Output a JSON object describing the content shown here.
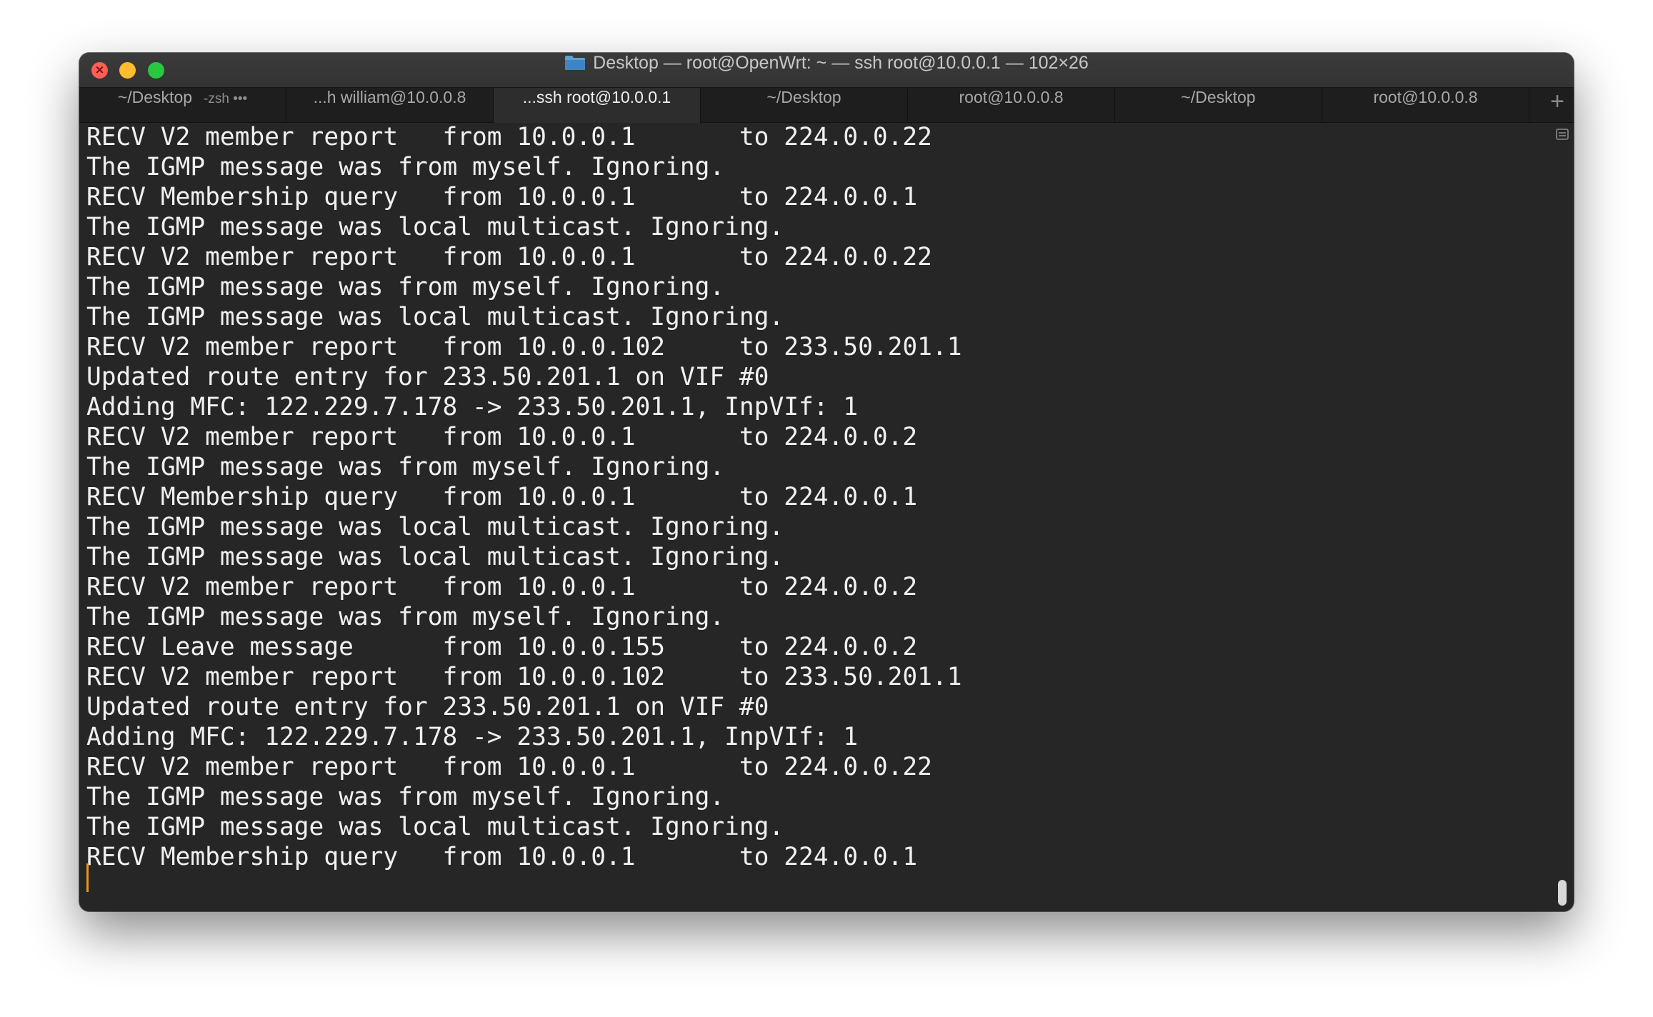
{
  "window": {
    "title": "Desktop — root@OpenWrt: ~ — ssh root@10.0.0.1 — 102×26",
    "title_icon": "folder-icon"
  },
  "tabs": [
    {
      "label": "~/Desktop",
      "sub": "-zsh •••",
      "active": false
    },
    {
      "label": "...h william@10.0.0.8",
      "active": false
    },
    {
      "label": "...ssh root@10.0.0.1",
      "active": true
    },
    {
      "label": "~/Desktop",
      "active": false
    },
    {
      "label": "root@10.0.0.8",
      "active": false
    },
    {
      "label": "~/Desktop",
      "active": false
    },
    {
      "label": "root@10.0.0.8",
      "active": false
    }
  ],
  "new_tab_label": "+",
  "terminal": {
    "lines": [
      "RECV V2 member report   from 10.0.0.1       to 224.0.0.22",
      "The IGMP message was from myself. Ignoring.",
      "RECV Membership query   from 10.0.0.1       to 224.0.0.1",
      "The IGMP message was local multicast. Ignoring.",
      "RECV V2 member report   from 10.0.0.1       to 224.0.0.22",
      "The IGMP message was from myself. Ignoring.",
      "The IGMP message was local multicast. Ignoring.",
      "RECV V2 member report   from 10.0.0.102     to 233.50.201.1",
      "Updated route entry for 233.50.201.1 on VIF #0",
      "Adding MFC: 122.229.7.178 -> 233.50.201.1, InpVIf: 1",
      "RECV V2 member report   from 10.0.0.1       to 224.0.0.2",
      "The IGMP message was from myself. Ignoring.",
      "RECV Membership query   from 10.0.0.1       to 224.0.0.1",
      "The IGMP message was local multicast. Ignoring.",
      "The IGMP message was local multicast. Ignoring.",
      "RECV V2 member report   from 10.0.0.1       to 224.0.0.2",
      "The IGMP message was from myself. Ignoring.",
      "RECV Leave message      from 10.0.0.155     to 224.0.0.2",
      "RECV V2 member report   from 10.0.0.102     to 233.50.201.1",
      "Updated route entry for 233.50.201.1 on VIF #0",
      "Adding MFC: 122.229.7.178 -> 233.50.201.1, InpVIf: 1",
      "RECV V2 member report   from 10.0.0.1       to 224.0.0.22",
      "The IGMP message was from myself. Ignoring.",
      "The IGMP message was local multicast. Ignoring.",
      "RECV Membership query   from 10.0.0.1       to 224.0.0.1"
    ],
    "cursor_color": "#e89420"
  },
  "colors": {
    "background": "#262626",
    "text": "#f0f0f0",
    "close": "#fe5f57",
    "minimize": "#febc2e",
    "zoom": "#28c840"
  }
}
